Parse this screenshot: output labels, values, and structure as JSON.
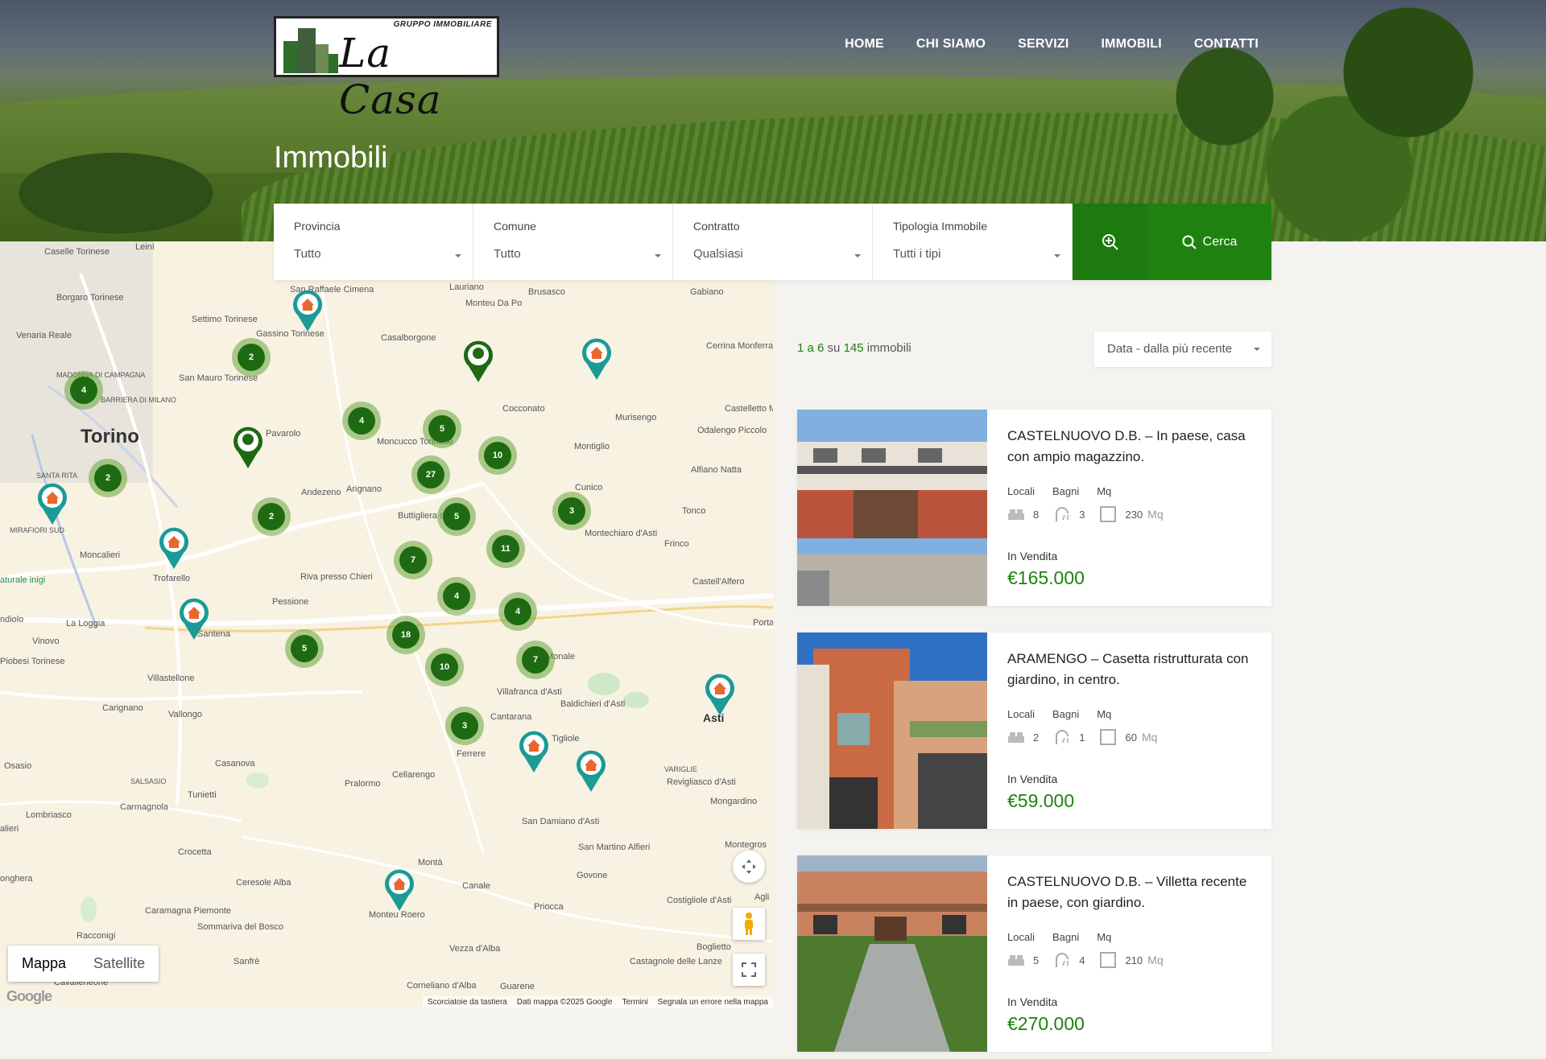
{
  "brand": {
    "tagline": "GRUPPO IMMOBILIARE",
    "name": "La Casa"
  },
  "nav": [
    "HOME",
    "CHI SIAMO",
    "SERVIZI",
    "IMMOBILI",
    "CONTATTI"
  ],
  "page_title": "Immobili",
  "search": {
    "fields": [
      {
        "label": "Provincia",
        "value": "Tutto"
      },
      {
        "label": "Comune",
        "value": "Tutto"
      },
      {
        "label": "Contratto",
        "value": "Qualsiasi"
      },
      {
        "label": "Tipologia Immobile",
        "value": "Tutti i tipi"
      }
    ],
    "submit_label": "Cerca",
    "advanced_icon": "zoom-in-icon",
    "submit_icon": "search-icon"
  },
  "map": {
    "map_type": [
      "Mappa",
      "Satellite"
    ],
    "footer": [
      "Scorciatoie da tastiera",
      "Dati mappa ©2025 Google",
      "Termini",
      "Segnala un errore nella mappa"
    ],
    "google": "Google",
    "places": {
      "torino": "Torino",
      "asti": "Asti",
      "caselle": "Caselle Torinese",
      "leini": "Leinì",
      "borgaro": "Borgaro Torinese",
      "venaria": "Venaria Reale",
      "settimo": "Settimo Torinese",
      "gassino": "Gassino Torinese",
      "sanraffaele": "San Raffaele Cimena",
      "lauriano": "Lauriano",
      "brusasco": "Brusasco",
      "gabiano": "Gabiano",
      "montendapo": "Monteu Da Po",
      "casalborgone": "Casalborgone",
      "cerrina": "Cerrina Monferrato",
      "sanmauro": "San Mauro Torinese",
      "madonna": "MADONNA DI CAMPAGNA",
      "barriera": "BARRIERA DI MILANO",
      "pavarolo": "Pavarolo",
      "cocconato": "Cocconato",
      "murisengo": "Murisengo",
      "castelletto": "Castelletto Merli",
      "odalengo": "Odalengo Piccolo",
      "montiglio": "Montiglio",
      "moncucco": "Moncucco Torinese",
      "santarita": "SANTA RITA",
      "mirafiori": "MIRAFIORI SUD",
      "andezeno": "Andezeno",
      "arignano": "Arignano",
      "alfiano": "Alfiano Natta",
      "cunico": "Cunico",
      "buttigliera": "Buttigliera d'Asti",
      "montechiaro": "Montechiaro d'Asti",
      "tonco": "Tonco",
      "frinco": "Frinco",
      "moncalieri": "Moncalieri",
      "trofarello": "Trofarello",
      "riva": "Riva presso Chieri",
      "castellalfero": "Castell'Alfero",
      "laloggia": "La Loggia",
      "pessione": "Pessione",
      "santena": "Santena",
      "vinovo": "Vinovo",
      "piobesi": "Piobesi Torinese",
      "monale": "Monale",
      "villastellone": "Villastellone",
      "carignano": "Carignano",
      "vallongo": "Vallongo",
      "villafranca": "Villafranca d'Asti",
      "cantarana": "Cantarana",
      "baldichieri": "Baldichieri d'Asti",
      "tigliole": "Tigliole",
      "ferrere": "Ferrere",
      "osasio": "Osasio",
      "casanova": "Casanova",
      "salsasio": "SALSASIO",
      "tunietti": "Tunietti",
      "pralormo": "Pralormo",
      "cellarengo": "Cellarengo",
      "carmagnola": "Carmagnola",
      "lombriasco": "Lombriasco",
      "variglie": "VARIGLIE",
      "revigliasco": "Revigliasco d'Asti",
      "mongardino": "Mongardino",
      "sandamiano": "San Damiano d'Asti",
      "crocetta": "Crocetta",
      "sanmartino": "San Martino Alfieri",
      "montegrosso": "Montegros",
      "monta": "Montà",
      "govone": "Govone",
      "ceresole": "Ceresole Alba",
      "canale": "Canale",
      "caramagna": "Caramagna Piemonte",
      "sommariva": "Sommariva del Bosco",
      "priocca": "Priocca",
      "costigliole": "Costigliole d'Asti",
      "montaroero": "Monteu Roero",
      "racconigi": "Racconigi",
      "sanfre": "Sanfrè",
      "vezza": "Vezza d'Alba",
      "boglietto": "Boglietto",
      "castagnole": "Castagnole delle Lanze",
      "cavallerleone": "Cavallerleone",
      "corneliano": "Corneliano d'Alba",
      "guarene": "Guarene",
      "porta": "Porta",
      "aglia": "Agli",
      "pinerolo": "ndiolo",
      "naturale": "aturale inigi",
      "onghera": "onghera",
      "allieri": "alieri"
    },
    "clusters": [
      "2",
      "4",
      "4",
      "5",
      "10",
      "27",
      "2",
      "2",
      "5",
      "3",
      "11",
      "7",
      "4",
      "4",
      "18",
      "5",
      "10",
      "7",
      "3"
    ]
  },
  "results": {
    "count_prefix": "1 a ",
    "count_to": "6",
    "count_mid": " su ",
    "count_total": "145",
    "count_suffix": " immobili",
    "sort_label": "Data - dalla più recente",
    "spec_labels": [
      "Locali",
      "Bagni",
      "Mq"
    ],
    "unit": "Mq",
    "listings": [
      {
        "title": "CASTELNUOVO D.B. – In paese, casa con ampio magazzino.",
        "locali": "8",
        "bagni": "3",
        "mq": "230",
        "status": "In Vendita",
        "price": "€165.000"
      },
      {
        "title": "ARAMENGO – Casetta ristrutturata con giardino, in centro.",
        "locali": "2",
        "bagni": "1",
        "mq": "60",
        "status": "In Vendita",
        "price": "€59.000"
      },
      {
        "title": "CASTELNUOVO D.B. – Villetta recente in paese, con giardino.",
        "locali": "5",
        "bagni": "4",
        "mq": "210",
        "status": "In Vendita",
        "price": "€270.000"
      }
    ]
  }
}
